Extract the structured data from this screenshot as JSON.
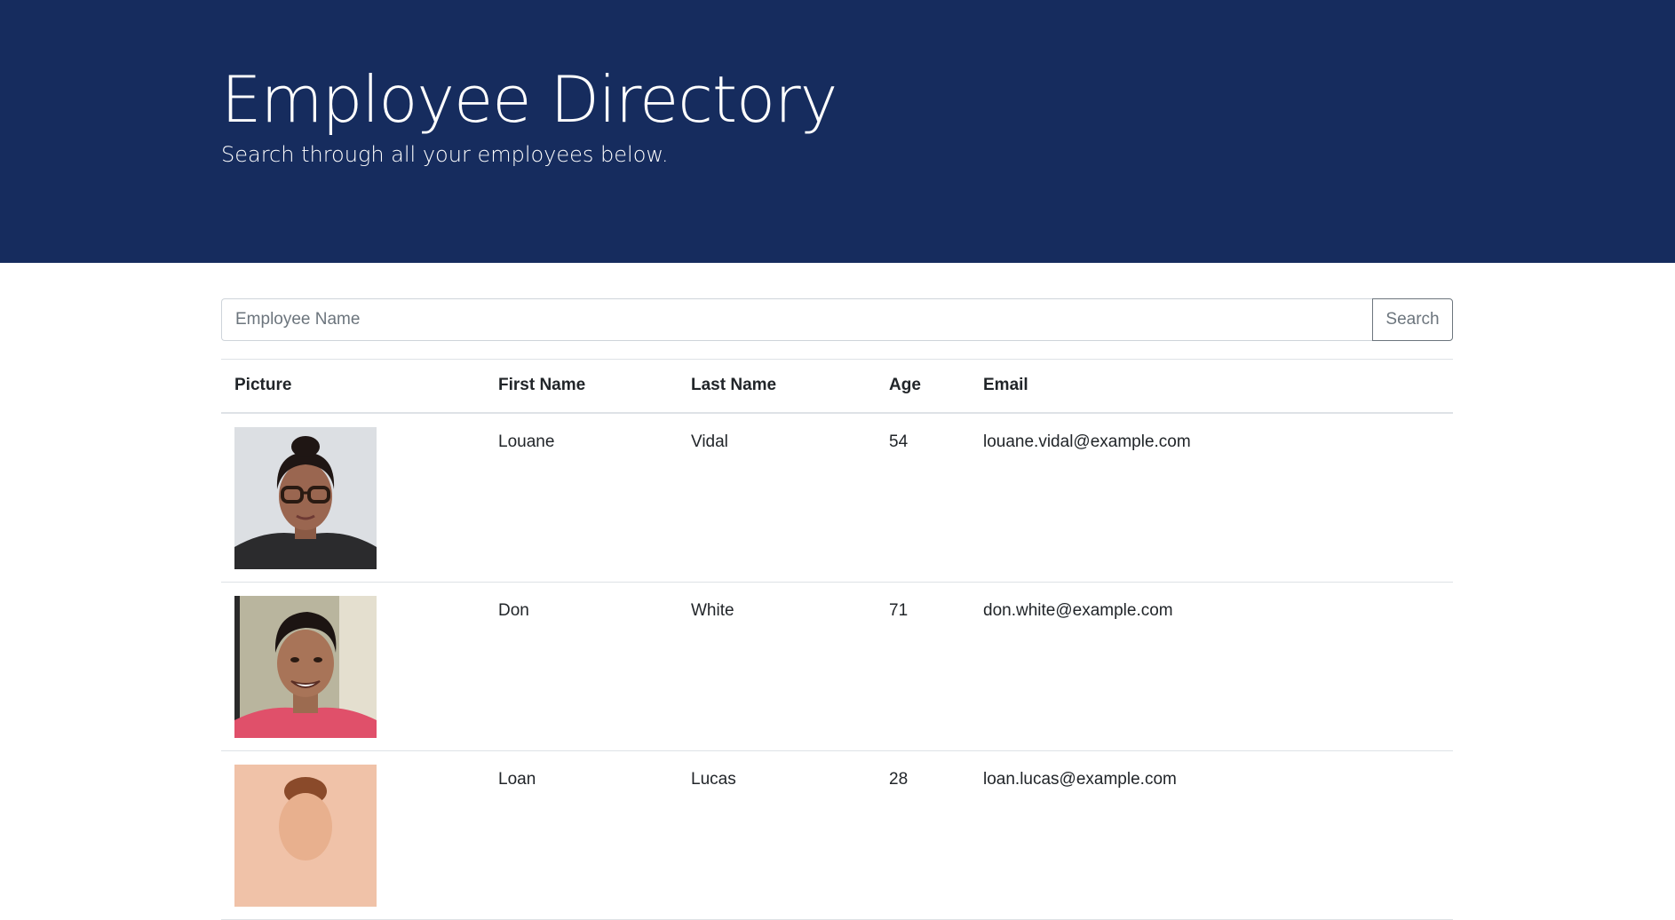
{
  "header": {
    "title": "Employee Directory",
    "subtitle": "Search through all your employees below.",
    "background_color": "#162c5e"
  },
  "search": {
    "placeholder": "Employee Name",
    "value": "",
    "button_label": "Search"
  },
  "table": {
    "columns": [
      "Picture",
      "First Name",
      "Last Name",
      "Age",
      "Email"
    ],
    "rows": [
      {
        "picture": "employee-photo",
        "first_name": "Louane",
        "last_name": "Vidal",
        "age": "54",
        "email": "louane.vidal@example.com"
      },
      {
        "picture": "employee-photo",
        "first_name": "Don",
        "last_name": "White",
        "age": "71",
        "email": "don.white@example.com"
      },
      {
        "picture": "employee-photo",
        "first_name": "Loan",
        "last_name": "Lucas",
        "age": "28",
        "email": "loan.lucas@example.com"
      }
    ]
  }
}
